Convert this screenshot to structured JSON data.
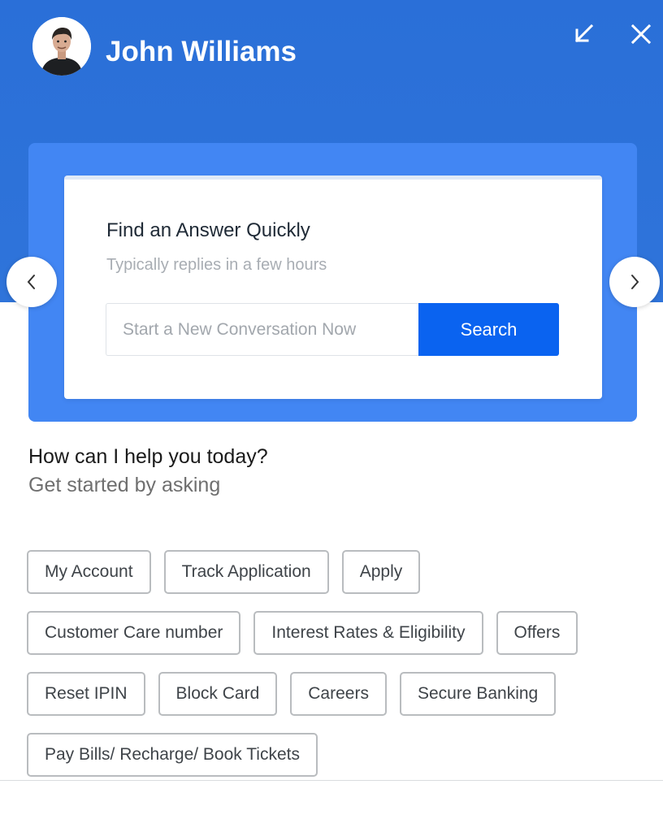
{
  "header": {
    "agent_name": "John Williams",
    "avatar_icon": "person-avatar-icon",
    "minimize_icon": "minimize-arrow-icon",
    "close_icon": "close-icon",
    "background_color": "#2f74da"
  },
  "carousel": {
    "card_color": "#4286f3",
    "title": "Find an Answer Quickly",
    "subtitle": "Typically replies in a few hours",
    "search_placeholder": "Start a New Conversation Now",
    "search_button_label": "Search",
    "search_button_color": "#0a63f0",
    "prev_icon": "chevron-left-icon",
    "next_icon": "chevron-right-icon"
  },
  "help": {
    "title": "How can I help you today?",
    "subtitle": "Get started by asking"
  },
  "chips": [
    [
      "My Account",
      "Track Application",
      "Apply"
    ],
    [
      "Customer Care number",
      "Interest Rates & Eligibility",
      "Offers"
    ],
    [
      "Reset IPIN",
      "Block Card",
      "Careers",
      "Secure Banking"
    ],
    [
      "Pay Bills/ Recharge/ Book Tickets"
    ]
  ]
}
